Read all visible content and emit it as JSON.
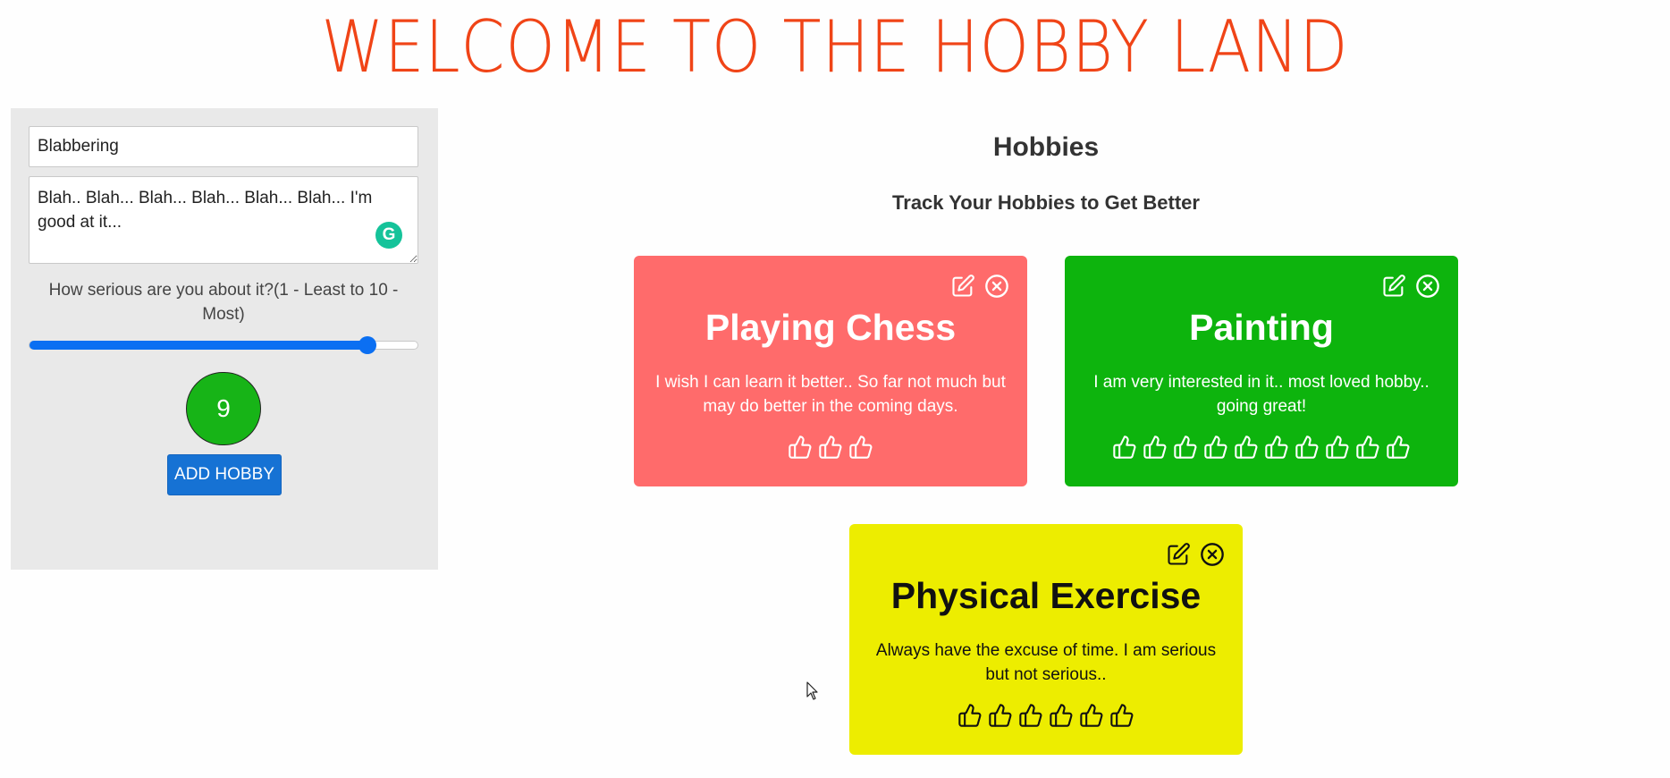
{
  "app": {
    "title": "WELCOME TO THE HOBBY LAND"
  },
  "form": {
    "hobby_name_value": "Blabbering",
    "description_value": "Blah.. Blah... Blah... Blah... Blah... Blah... I'm good at it...",
    "grammarly_glyph": "G",
    "seriousness_label": "How serious are you about it?(1 - Least to 10 - Most)",
    "seriousness_min": 1,
    "seriousness_max": 10,
    "seriousness_value": 9,
    "seriousness_display": "9",
    "add_button_label": "ADD HOBBY"
  },
  "hobbies": {
    "heading": "Hobbies",
    "subheading": "Track Your Hobbies to Get Better",
    "cards": [
      {
        "title": "Playing Chess",
        "description": "I wish I can learn it better.. So far not much but may do better in the coming days.",
        "rating": 3,
        "color": "#ff6b6b",
        "text_color": "#ffffff"
      },
      {
        "title": "Painting",
        "description": "I am very interested in it.. most loved hobby.. going great!",
        "rating": 10,
        "color": "#0db40d",
        "text_color": "#ffffff"
      },
      {
        "title": "Physical Exercise",
        "description": "Always have the excuse of time. I am serious but not serious..",
        "rating": 6,
        "color": "#eded00",
        "text_color": "#111111"
      }
    ]
  },
  "icons": {
    "edit": "edit-icon",
    "delete": "close-circle-icon",
    "rating": "thumbs-up-icon",
    "cursor": "mouse-cursor-icon"
  }
}
